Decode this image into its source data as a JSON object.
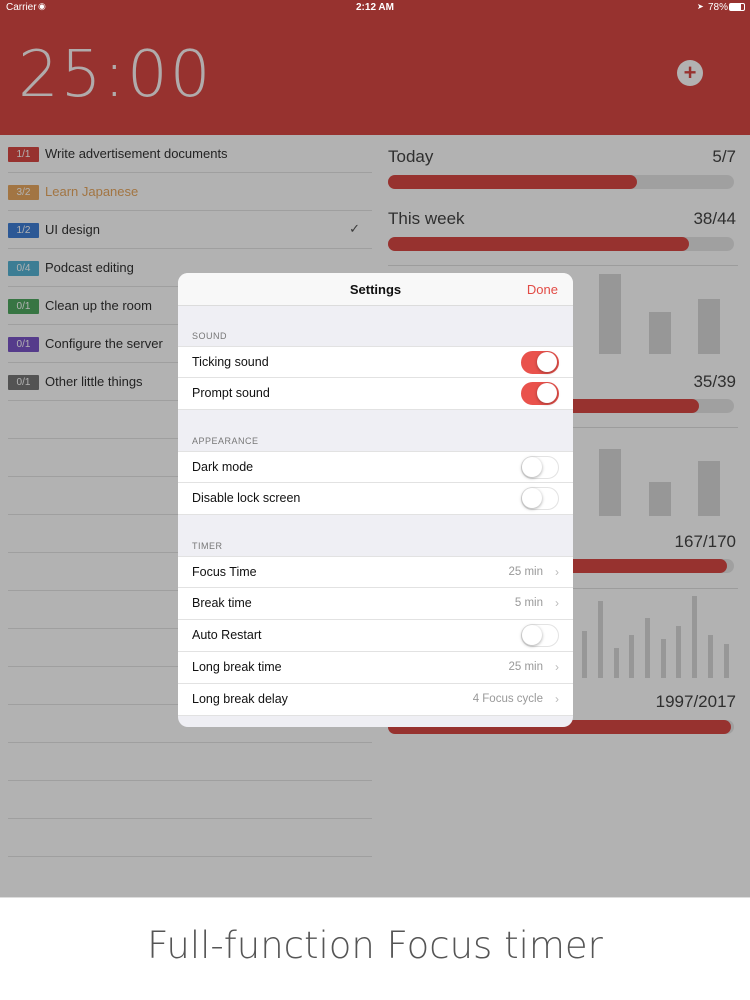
{
  "status_bar": {
    "carrier": "Carrier",
    "time": "2:12 AM",
    "battery": "78%"
  },
  "header": {
    "timer": "25:00",
    "add_icon": "plus-icon"
  },
  "tasks": [
    {
      "count": "1/1",
      "name": "Write advertisement documents",
      "color": "#d94844",
      "done": false
    },
    {
      "count": "3/2",
      "name": "Learn Japanese",
      "color": "#e8a860",
      "done": false
    },
    {
      "count": "1/2",
      "name": "UI design",
      "color": "#3f7fd6",
      "done": true
    },
    {
      "count": "0/4",
      "name": "Podcast editing",
      "color": "#57b4d4",
      "done": false
    },
    {
      "count": "0/1",
      "name": "Clean up the room",
      "color": "#4fa860",
      "done": false
    },
    {
      "count": "0/1",
      "name": "Configure the server",
      "color": "#7a55c8",
      "done": false
    },
    {
      "count": "0/1",
      "name": "Other little things",
      "color": "#777777",
      "done": false
    }
  ],
  "stats": [
    {
      "label": "Today",
      "value": "5/7",
      "progress": 0.72
    },
    {
      "label": "This week",
      "value": "38/44",
      "progress": 0.87
    },
    {
      "label": "",
      "value": "35/39",
      "progress": 0.9
    },
    {
      "label": "",
      "value": "167/170",
      "progress": 0.98
    },
    {
      "label": "",
      "value": "1997/2017",
      "progress": 0.99
    }
  ],
  "settings": {
    "title": "Settings",
    "done_label": "Done",
    "sections": {
      "sound": "SOUND",
      "appearance": "APPEARANCE",
      "timer": "TIMER"
    },
    "ticking_sound": {
      "label": "Ticking sound",
      "on": true
    },
    "prompt_sound": {
      "label": "Prompt sound",
      "on": true
    },
    "dark_mode": {
      "label": "Dark mode",
      "on": false
    },
    "disable_lock": {
      "label": "Disable lock screen",
      "on": false
    },
    "focus_time": {
      "label": "Focus Time",
      "value": "25 min"
    },
    "break_time": {
      "label": "Break time",
      "value": "5 min"
    },
    "auto_restart": {
      "label": "Auto Restart",
      "on": false
    },
    "long_break_time": {
      "label": "Long break time",
      "value": "25 min"
    },
    "long_break_delay": {
      "label": "Long break delay",
      "value": "4 Focus cycle"
    }
  },
  "footer": {
    "caption": "Full-function Focus timer"
  },
  "colors": {
    "accent": "#d94844",
    "toggle_on": "#e9524c"
  }
}
